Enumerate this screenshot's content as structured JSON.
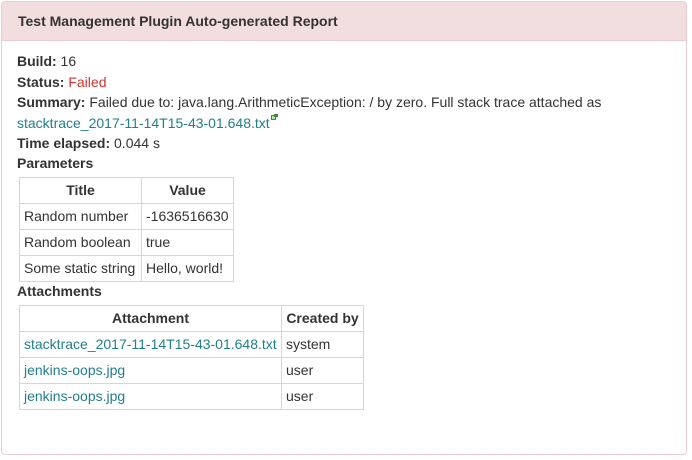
{
  "report": {
    "title": "Test Management Plugin Auto-generated Report",
    "build_label": "Build:",
    "build_value": "16",
    "status_label": "Status:",
    "status_value": "Failed",
    "summary_label": "Summary:",
    "summary_text": "Failed due to: java.lang.ArithmeticException: / by zero. Full stack trace attached as",
    "summary_link": "stacktrace_2017-11-14T15-43-01.648.txt",
    "time_label": "Time elapsed:",
    "time_value": "0.044 s"
  },
  "parameters": {
    "heading": "Parameters",
    "columns": [
      "Title",
      "Value"
    ],
    "rows": [
      {
        "title": "Random number",
        "value": "-1636516630"
      },
      {
        "title": "Random boolean",
        "value": "true"
      },
      {
        "title": "Some static string",
        "value": "Hello, world!"
      }
    ]
  },
  "attachments": {
    "heading": "Attachments",
    "columns": [
      "Attachment",
      "Created by"
    ],
    "rows": [
      {
        "name": "stacktrace_2017-11-14T15-43-01.648.txt",
        "created_by": "system"
      },
      {
        "name": "jenkins-oops.jpg",
        "created_by": "user"
      },
      {
        "name": "jenkins-oops.jpg",
        "created_by": "user"
      }
    ]
  },
  "colors": {
    "heading_bg": "#f2dede",
    "heading_border": "#ebccd1",
    "status_failed": "#d9312c",
    "link": "#217f8c"
  },
  "icons": {
    "external_link": "external-link-icon"
  }
}
